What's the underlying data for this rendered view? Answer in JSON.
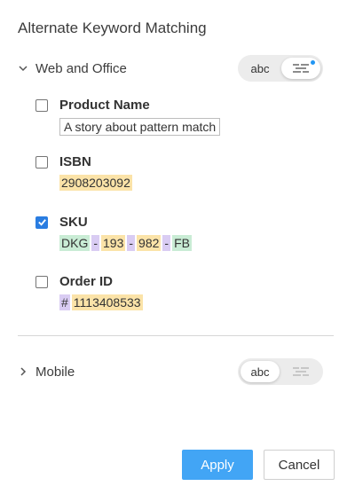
{
  "dialog": {
    "title": "Alternate Keyword Matching"
  },
  "sections": {
    "web": {
      "label": "Web and Office",
      "toggle_text": "abc",
      "fields": {
        "product_name": {
          "label": "Product Name",
          "checked": false,
          "value": "A story about pattern match"
        },
        "isbn": {
          "label": "ISBN",
          "checked": false,
          "value": "2908203092"
        },
        "sku": {
          "label": "SKU",
          "checked": true,
          "segments": [
            "DKG",
            "-",
            "193",
            "-",
            "982",
            "-",
            "FB"
          ]
        },
        "order_id": {
          "label": "Order ID",
          "checked": false,
          "segments": [
            "#",
            "1113408533"
          ]
        }
      }
    },
    "mobile": {
      "label": "Mobile",
      "toggle_text": "abc"
    }
  },
  "buttons": {
    "apply": "Apply",
    "cancel": "Cancel"
  },
  "colors": {
    "accent": "#42a5f5",
    "checkbox": "#2a7de1",
    "highlight_yellow": "#fbe3a8",
    "highlight_green": "#c9ecd5",
    "highlight_purple": "#d9ccf3",
    "indicator_dot": "#2196f3"
  },
  "icons": {
    "web_section": "chevron-down-icon",
    "mobile_section": "chevron-right-icon",
    "pattern_mode": "pattern-lines-icon"
  }
}
